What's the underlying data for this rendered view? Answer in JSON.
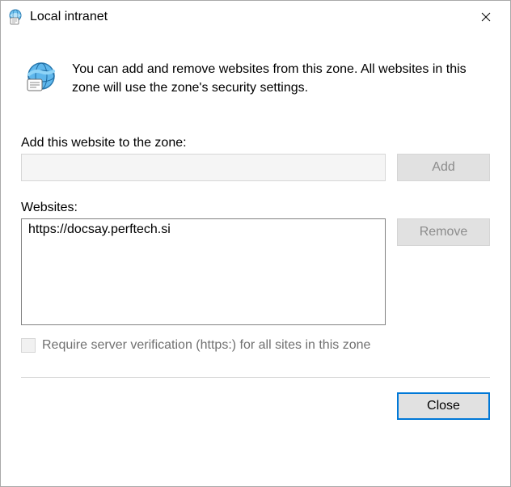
{
  "title": "Local intranet",
  "info_text": "You can add and remove websites from this zone. All websites in this zone will use the zone's security settings.",
  "add_label": "Add this website to the zone:",
  "add_input_value": "",
  "add_button": "Add",
  "websites_label": "Websites:",
  "websites": [
    "https://docsay.perftech.si"
  ],
  "remove_button": "Remove",
  "require_verification_label": "Require server verification (https:) for all sites in this zone",
  "close_button": "Close"
}
